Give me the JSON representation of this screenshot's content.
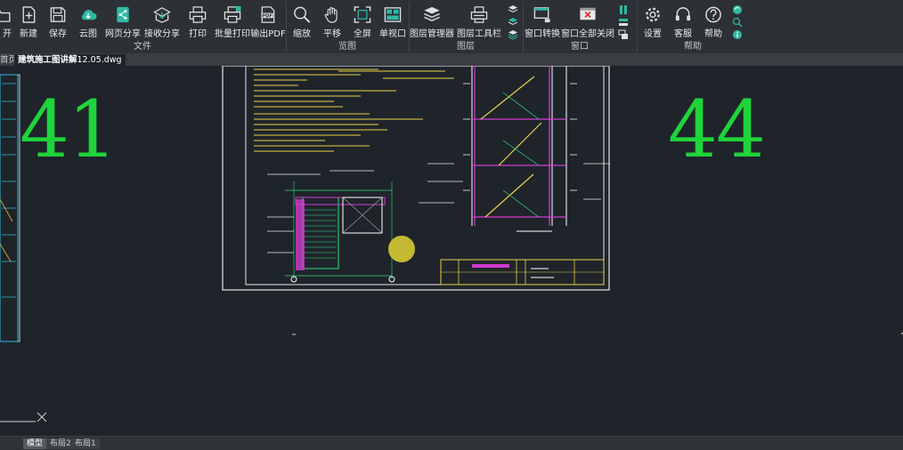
{
  "ribbon": {
    "groups": {
      "file": "文件",
      "view": "览图",
      "layer": "图层",
      "window": "窗口",
      "help": "帮助"
    },
    "tools": {
      "open": "开",
      "new": "新建",
      "save": "保存",
      "cloud": "云图",
      "web_share": "网页分享",
      "receive_share": "接收分享",
      "print": "打印",
      "batch_print": "批量打印",
      "export_pdf": "输出PDF",
      "zoom": "缩放",
      "pan": "平移",
      "fullscreen": "全屏",
      "single_window": "单视口",
      "layer_manager": "图层管理器",
      "layer_toolbar": "图层工具栏",
      "window_switch": "窗口转换",
      "close_all": "窗口全部关闭",
      "settings": "设置",
      "service": "客服",
      "help": "帮助"
    },
    "pdf_badge": "PDF"
  },
  "tabs": {
    "home": "首页",
    "file": "建筑施工图讲解",
    "file_suffix": "12.05.dwg"
  },
  "canvas": {
    "left_page_number": "41",
    "right_page_number": "44"
  },
  "layouts": {
    "model": "模型",
    "layout1": "布局1",
    "layout2": "布局2"
  },
  "colors": {
    "drawing_green": "#1fd43a",
    "ribbon_bg": "#2d3035",
    "canvas_bg": "#1f242b",
    "icon_teal": "#2fb8a4",
    "close_red": "#d9322b"
  }
}
